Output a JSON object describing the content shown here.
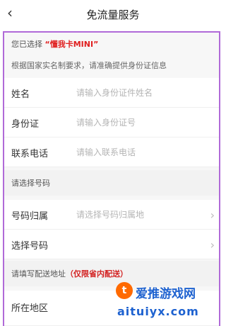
{
  "header": {
    "back_icon": "chevron-left-icon",
    "back_glyph": "‹",
    "title": "免流量服务"
  },
  "selection": {
    "prefix": "您已选择",
    "product": "“懂我卡MINI”"
  },
  "notice": "根据国家实名制要求，请准确提供身份证信息",
  "form": {
    "name": {
      "label": "姓名",
      "placeholder": "请输入身份证件姓名"
    },
    "id": {
      "label": "身份证",
      "placeholder": "请输入身份证号"
    },
    "phone": {
      "label": "联系电话",
      "placeholder": "请输入联系电话"
    }
  },
  "number_section": {
    "title": "请选择号码",
    "location": {
      "label": "号码归属",
      "placeholder": "请选择号码归属地",
      "chevron": "›"
    },
    "pick": {
      "label": "选择号码",
      "chevron": "›"
    }
  },
  "address_section": {
    "title": "请填写配送地址",
    "note": "（仅限省内配送）",
    "region": {
      "label": "所在地区"
    }
  },
  "watermark": {
    "logo": "t",
    "text": "爱推游戏网",
    "domain": "aituiyx.com"
  },
  "colors": {
    "accent": "#e02020",
    "border": "#b06ad8",
    "placeholder": "#b5b5b5",
    "watermark": "#1e62d0"
  }
}
